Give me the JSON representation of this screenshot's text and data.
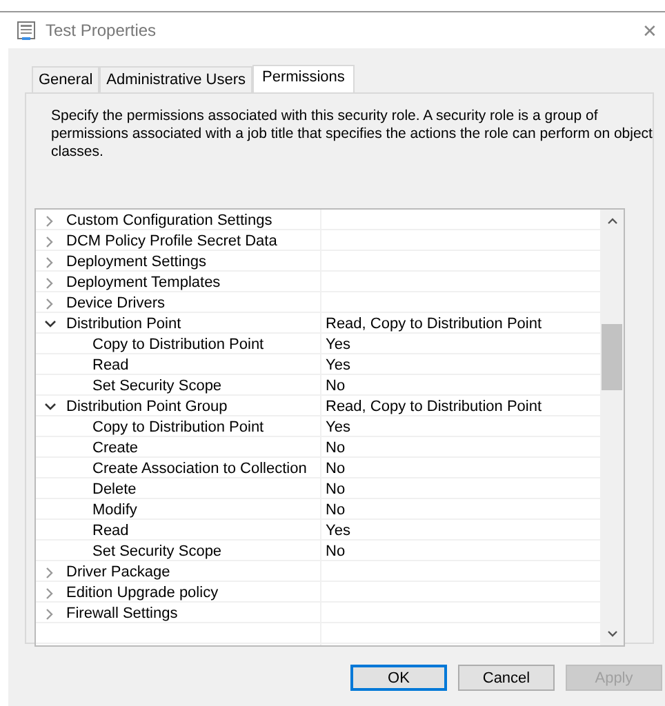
{
  "window": {
    "title": "Test Properties",
    "close": "✕"
  },
  "tabs": [
    {
      "label": "General",
      "selected": false
    },
    {
      "label": "Administrative Users",
      "selected": false
    },
    {
      "label": "Permissions",
      "selected": true
    }
  ],
  "description": "Specify the permissions associated with this security role. A security role is a group of permissions associated with a job title that specifies the actions the role can perform on object classes.",
  "permissions": [
    {
      "name": "Custom Configuration Settings",
      "expanded": false
    },
    {
      "name": "DCM Policy Profile Secret Data",
      "expanded": false
    },
    {
      "name": "Deployment Settings",
      "expanded": false
    },
    {
      "name": "Deployment Templates",
      "expanded": false
    },
    {
      "name": "Device Drivers",
      "expanded": false
    },
    {
      "name": "Distribution Point",
      "value": "Read, Copy to Distribution Point",
      "expanded": true,
      "children": [
        {
          "name": "Copy to Distribution Point",
          "value": "Yes"
        },
        {
          "name": "Read",
          "value": "Yes"
        },
        {
          "name": "Set Security Scope",
          "value": "No"
        }
      ]
    },
    {
      "name": "Distribution Point Group",
      "value": "Read, Copy to Distribution Point",
      "expanded": true,
      "children": [
        {
          "name": "Copy to Distribution Point",
          "value": "Yes"
        },
        {
          "name": "Create",
          "value": "No"
        },
        {
          "name": "Create Association to Collection",
          "value": "No"
        },
        {
          "name": "Delete",
          "value": "No"
        },
        {
          "name": "Modify",
          "value": "No"
        },
        {
          "name": "Read",
          "value": "Yes"
        },
        {
          "name": "Set Security Scope",
          "value": "No"
        }
      ]
    },
    {
      "name": "Driver Package",
      "expanded": false
    },
    {
      "name": "Edition Upgrade policy",
      "expanded": false
    },
    {
      "name": "Firewall Settings",
      "expanded": false
    }
  ],
  "buttons": [
    {
      "label": "OK",
      "kind": "default"
    },
    {
      "label": "Cancel",
      "kind": "normal"
    },
    {
      "label": "Apply",
      "kind": "disabled"
    }
  ]
}
